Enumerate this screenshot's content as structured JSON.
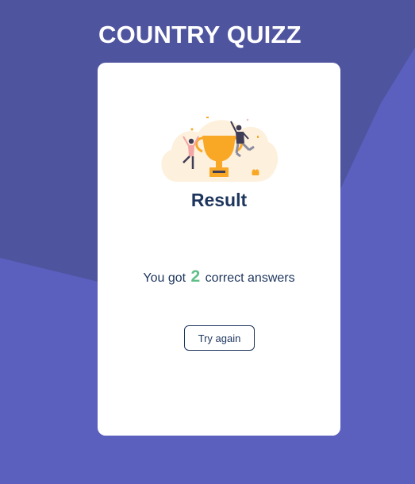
{
  "app": {
    "title": "COUNTRY QUIZZ"
  },
  "result": {
    "heading": "Result",
    "prefix": "You got",
    "score": "2",
    "suffix": "correct answers",
    "try_again_label": "Try again"
  },
  "icons": {
    "illustration": "winners-trophy-icon"
  },
  "colors": {
    "background": "#5b60bf",
    "background_shape": "#4f549f",
    "card": "#ffffff",
    "heading": "#1d355d",
    "score": "#60bf88",
    "trophy": "#f9a826"
  }
}
